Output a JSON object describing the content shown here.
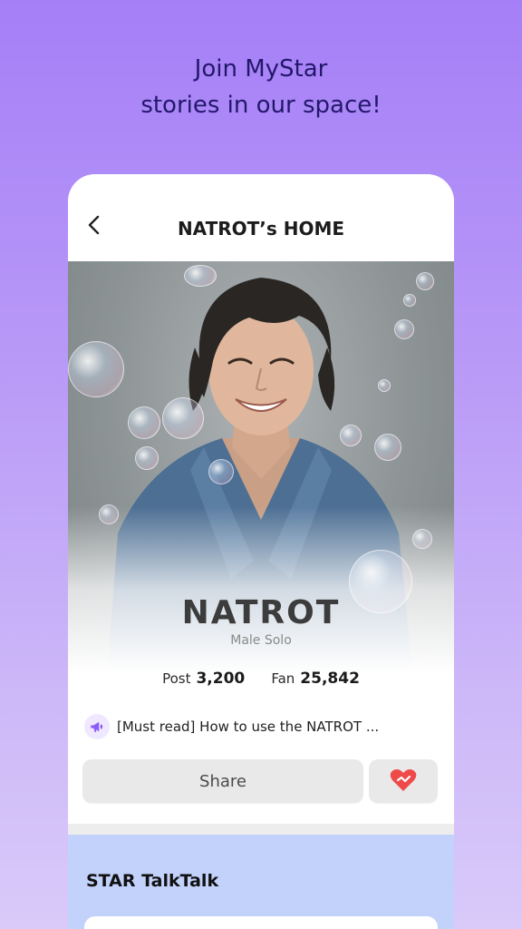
{
  "promo": {
    "line1": "Join MyStar",
    "line2": "stories in our space!"
  },
  "header": {
    "title": "NATROT’s HOME",
    "back_icon": "chevron-left-icon"
  },
  "profile": {
    "name": "NATROT",
    "category": "Male Solo",
    "post_label": "Post",
    "post_count": "3,200",
    "fan_label": "Fan",
    "fan_count": "25,842"
  },
  "notice": {
    "icon": "megaphone-icon",
    "text": "[Must read] How to use the NATROT ..."
  },
  "actions": {
    "share_label": "Share",
    "heart_icon": "heart-icon"
  },
  "talk": {
    "title": "STAR TalkTalk"
  },
  "colors": {
    "accent": "#8b5cf6",
    "heart": "#ef4a4a",
    "talk_bg": "#c3d2fb",
    "promo_text": "#23186b"
  }
}
